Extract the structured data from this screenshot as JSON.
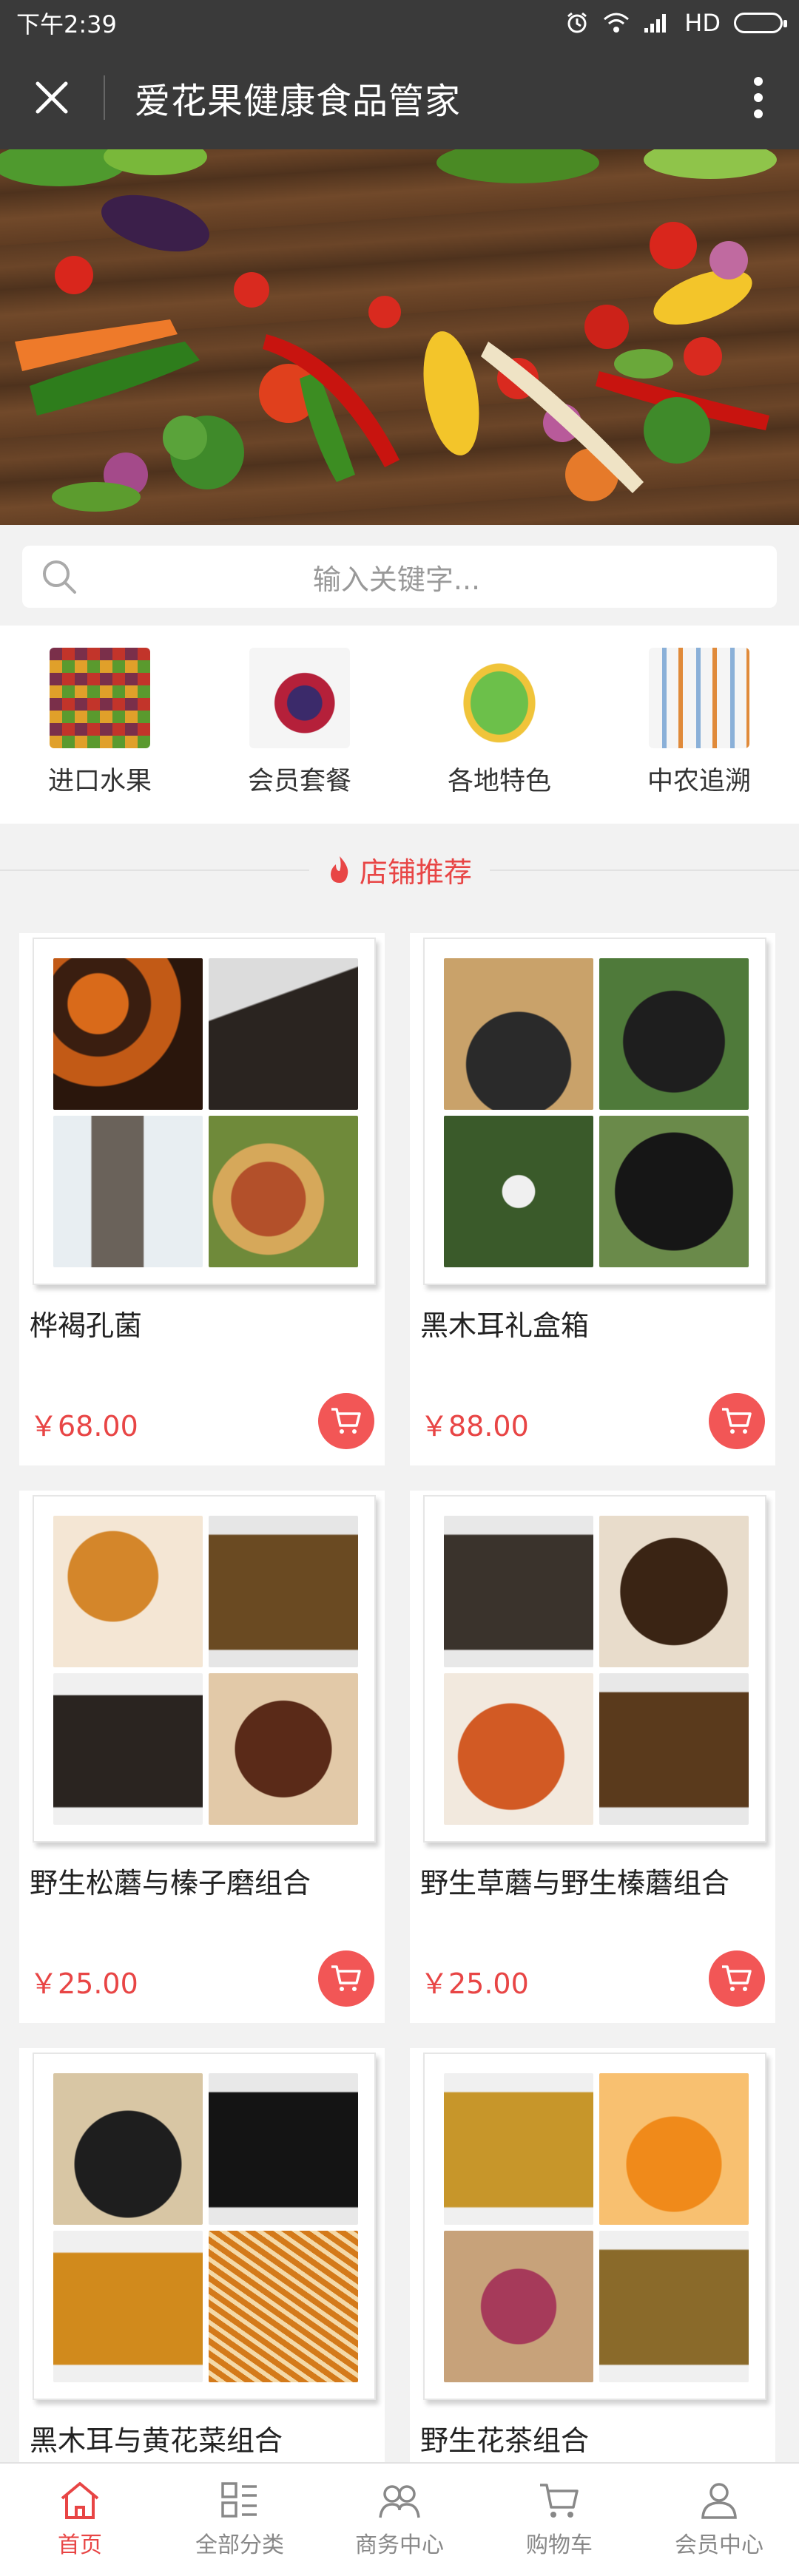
{
  "status_bar": {
    "time": "下午2:39",
    "network": "HD"
  },
  "header": {
    "title": "爱花果健康食品管家"
  },
  "search": {
    "placeholder": "输入关键字..."
  },
  "categories": [
    {
      "label": "进口水果",
      "icon": "imported-fruit-image"
    },
    {
      "label": "会员套餐",
      "icon": "member-package-image"
    },
    {
      "label": "各地特色",
      "icon": "regional-map-image"
    },
    {
      "label": "中农追溯",
      "icon": "traceability-image"
    }
  ],
  "section": {
    "title": "店铺推荐",
    "icon": "fire-icon"
  },
  "products": [
    {
      "name": "桦褐孔菌",
      "price": "￥68.00"
    },
    {
      "name": "黑木耳礼盒箱",
      "price": "￥88.00"
    },
    {
      "name": "野生松蘑与榛子磨组合",
      "price": "￥25.00"
    },
    {
      "name": "野生草蘑与野生榛蘑组合",
      "price": "￥25.00"
    },
    {
      "name": "黑木耳与黄花菜组合",
      "price": ""
    },
    {
      "name": "野生花茶组合",
      "price": ""
    }
  ],
  "tabbar": [
    {
      "label": "首页",
      "icon": "home-icon",
      "active": true
    },
    {
      "label": "全部分类",
      "icon": "category-icon",
      "active": false
    },
    {
      "label": "商务中心",
      "icon": "business-icon",
      "active": false
    },
    {
      "label": "购物车",
      "icon": "cart-icon",
      "active": false
    },
    {
      "label": "会员中心",
      "icon": "user-icon",
      "active": false
    }
  ],
  "colors": {
    "accent": "#e84545",
    "header_bg": "#3a3a3a"
  }
}
